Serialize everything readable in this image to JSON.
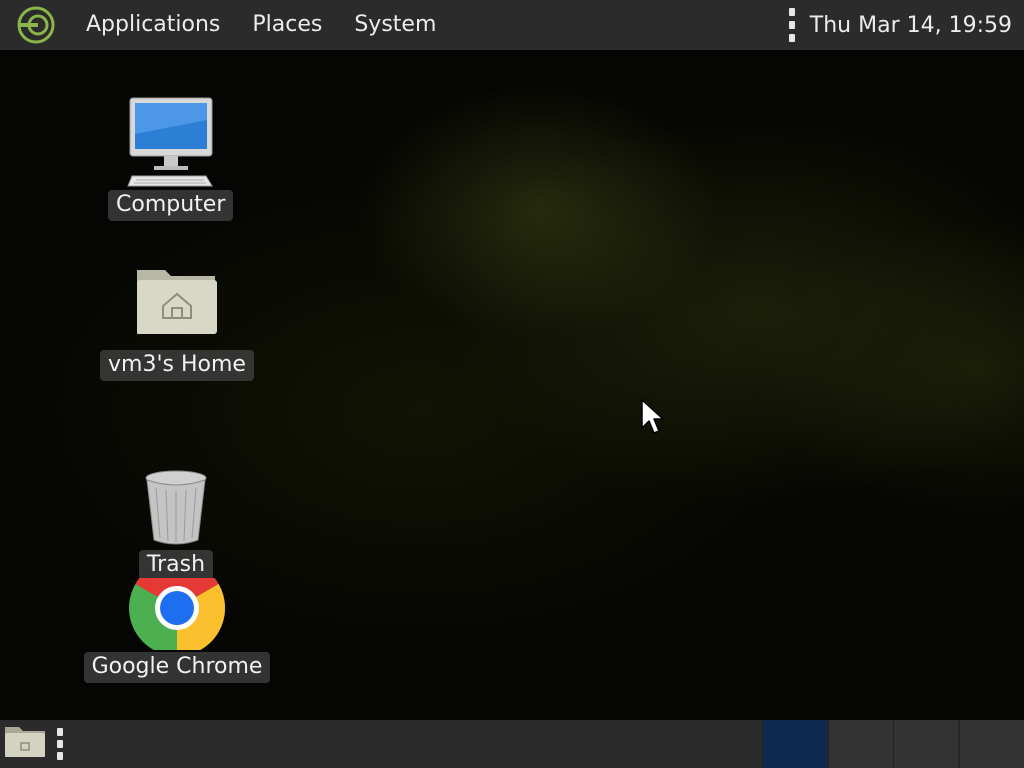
{
  "top_panel": {
    "menus": [
      "Applications",
      "Places",
      "System"
    ],
    "clock": "Thu Mar 14, 19:59"
  },
  "desktop_icons": [
    {
      "label": "Computer",
      "icon": "computer-icon"
    },
    {
      "label": "vm3's Home",
      "icon": "home-folder-icon"
    },
    {
      "label": "Trash",
      "icon": "trash-icon"
    },
    {
      "label": "Google Chrome",
      "icon": "chrome-icon"
    }
  ],
  "bottom_panel": {
    "workspaces": 4,
    "active_workspace": 1,
    "show_desktop_icon": "folder-icon"
  },
  "colors": {
    "panel_bg": "#2b2b2b",
    "active_workspace": "#0f2a50",
    "logo_green": "#8bb548"
  }
}
